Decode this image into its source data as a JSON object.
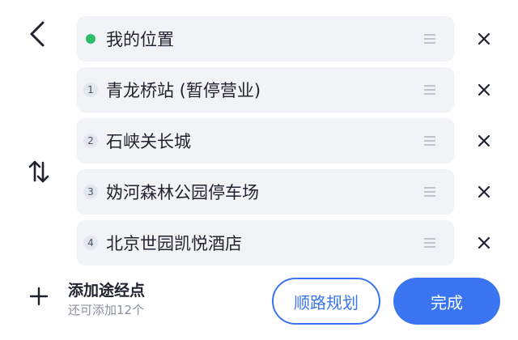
{
  "icons": {
    "back": "chevron-left-icon",
    "swap": "swap-vertical-icon",
    "drag": "drag-handle-icon",
    "remove": "close-icon",
    "add": "plus-icon"
  },
  "colors": {
    "accent": "#3a74f0",
    "current_location_dot": "#2cbe6a",
    "row_background": "#f1f3f6"
  },
  "stops": [
    {
      "badge": "",
      "label": "我的位置"
    },
    {
      "badge": "1",
      "label": "青龙桥站 (暂停营业)"
    },
    {
      "badge": "2",
      "label": "石峡关长城"
    },
    {
      "badge": "3",
      "label": "妫河森林公园停车场"
    },
    {
      "badge": "4",
      "label": "北京世园凯悦酒店"
    }
  ],
  "add_waypoint": {
    "title": "添加途经点",
    "subtitle": "还可添加12个"
  },
  "buttons": {
    "route_planning": "顺路规划",
    "done": "完成"
  }
}
